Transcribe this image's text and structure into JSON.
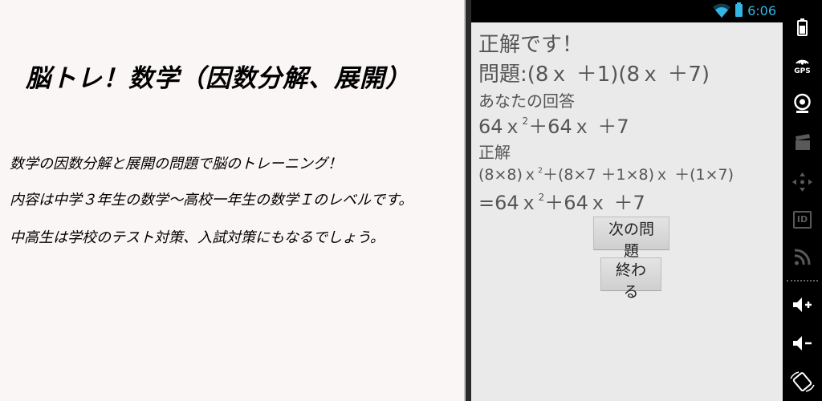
{
  "promo": {
    "title": "脳トレ！数学（因数分解、展開）",
    "lines": [
      "数学の因数分解と展開の問題で脳のトレーニング！",
      "内容は中学３年生の数学〜高校一年生の数学Ｉのレベルです。",
      "中高生は学校のテスト対策、入試対策にもなるでしょう。"
    ]
  },
  "status_bar": {
    "time": "6:06"
  },
  "quiz": {
    "result": "正解です！",
    "problem_label": "問題:",
    "problem": "(8ｘ ＋1)(8ｘ ＋7)",
    "your_answer_label": "あなたの回答",
    "your_answer": {
      "a": "64ｘ",
      "exp": "2",
      "b": "＋64ｘ ＋7"
    },
    "answer_label": "正解",
    "steps": {
      "a": "(8×8)ｘ",
      "exp": "2",
      "b": "＋(8×7 ＋1×8)ｘ ＋(1×7)"
    },
    "final": {
      "a": "=64ｘ",
      "exp": "2",
      "b": "＋64ｘ ＋7"
    }
  },
  "buttons": {
    "next": "次の問題",
    "end": "終わる"
  },
  "system_bar": {
    "gps_label": "GPS",
    "id_label": "ID",
    "icons": [
      "battery-icon",
      "gps-icon",
      "camera-icon",
      "clapper-icon",
      "dpad-icon",
      "id-icon",
      "rss-icon",
      "volume-up-icon",
      "volume-down-icon",
      "rotate-icon"
    ]
  },
  "colors": {
    "accent": "#33b5e5",
    "screen_bg": "#eaeaea",
    "text": "#555555"
  }
}
